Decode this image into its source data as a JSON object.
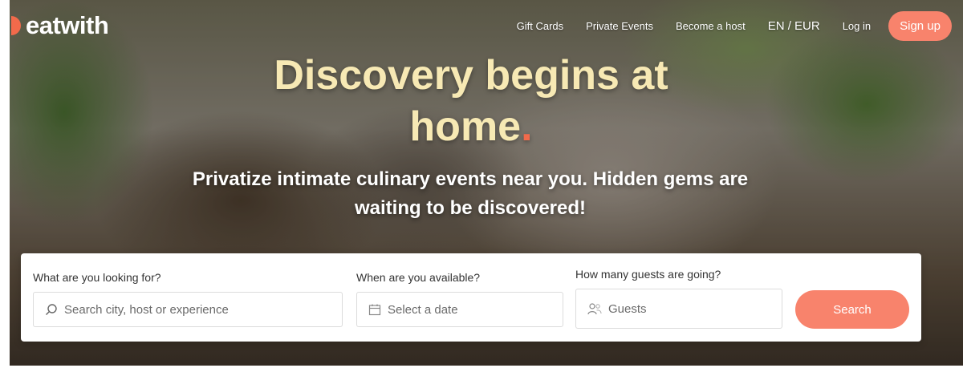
{
  "brand": {
    "logo_text": "eatwith",
    "accent": "#f26a4b",
    "button_color": "#f8836c"
  },
  "nav": {
    "gift_cards": "Gift Cards",
    "private_events": "Private Events",
    "become_host": "Become a host",
    "language": "EN / EUR",
    "login": "Log in",
    "signup": "Sign up"
  },
  "hero": {
    "headline_part1": "Discovery begins at",
    "headline_part2": "home",
    "headline_dot": ".",
    "subline": "Privatize intimate culinary events near you. Hidden gems are waiting to be discovered!"
  },
  "search": {
    "what_label": "What are you looking for?",
    "what_placeholder": "Search city, host or experience",
    "when_label": "When are you available?",
    "when_placeholder": "Select a date",
    "guests_label": "How many guests are going?",
    "guests_placeholder": "Guests",
    "button": "Search"
  },
  "icons": {
    "what": "search-icon",
    "when": "calendar-icon",
    "guests": "guests-icon"
  }
}
